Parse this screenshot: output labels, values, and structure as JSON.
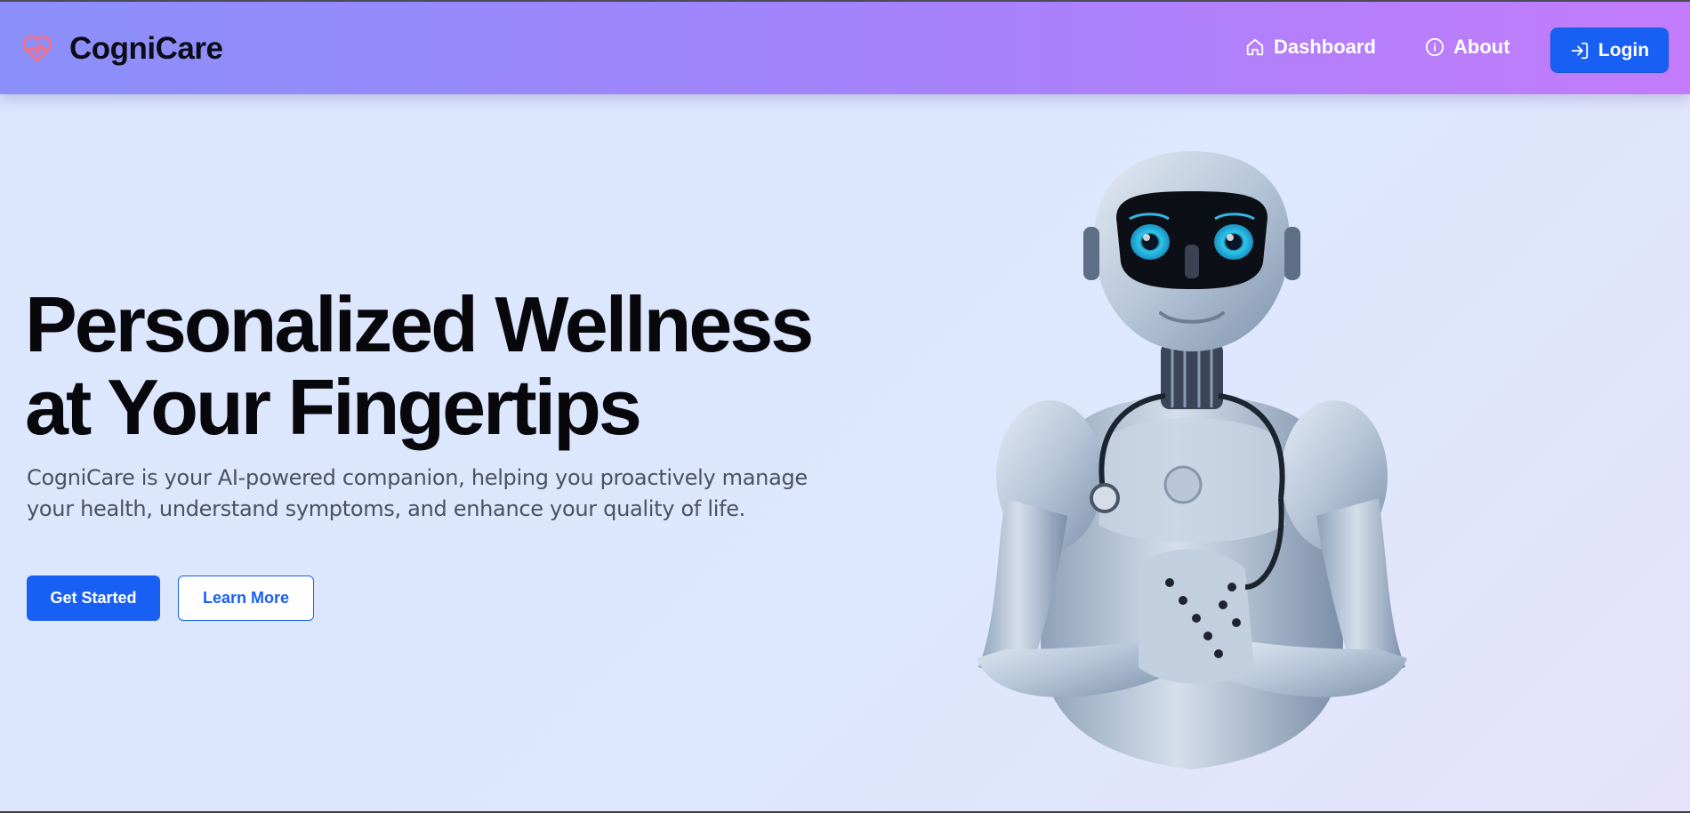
{
  "header": {
    "brand_name": "CogniCare",
    "brand_icon": "heart-pulse-icon",
    "nav": [
      {
        "label": "Dashboard",
        "icon": "home-icon"
      },
      {
        "label": "About",
        "icon": "info-icon"
      }
    ],
    "login_label": "Login",
    "login_icon": "login-icon"
  },
  "hero": {
    "title_line1": "Personalized Wellness",
    "title_line2": "at Your Fingertips",
    "subtitle": "CogniCare is your AI-powered companion, helping you proactively manage your health, understand symptoms, and enhance your quality of life.",
    "primary_cta": "Get Started",
    "secondary_cta": "Learn More",
    "image": "robot-doctor-illustration"
  },
  "colors": {
    "accent": "#1860f4",
    "navbar_gradient_start": "#8b90fb",
    "navbar_gradient_end": "#c27cfb",
    "background": "#dde7fd",
    "brand_icon": "#f0728c"
  }
}
